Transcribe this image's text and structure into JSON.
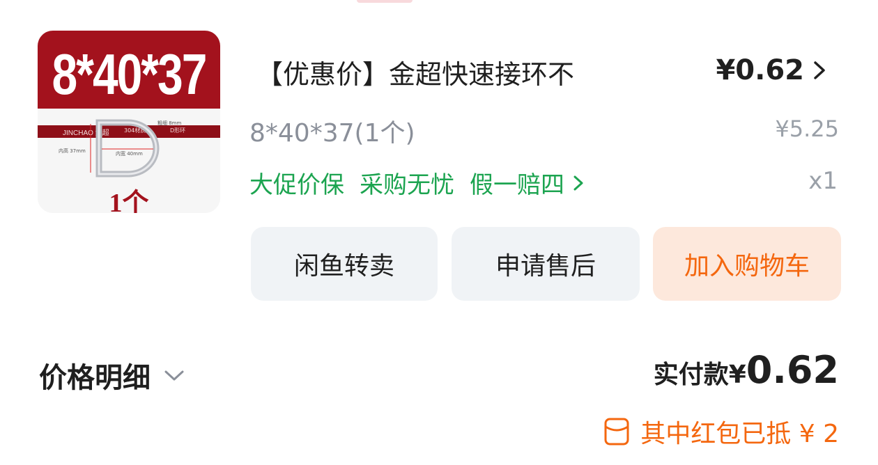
{
  "product": {
    "thumbnail": {
      "headline": "8*40*37",
      "brand": "JINCHAO 金超",
      "material_tag": "304材质",
      "shape_tag": "D形环",
      "count": "1个",
      "dim_inner_height": "内高 37mm",
      "dim_inner_width": "内宽 40mm",
      "dim_thickness": "粗细 8mm"
    },
    "title": "【优惠价】金超快速接环不",
    "price": "¥0.62",
    "spec": "8*40*37(1个)",
    "original_price": "¥5.25",
    "tags": [
      "大促价保",
      "采购无忧",
      "假一赔四"
    ],
    "quantity": "x1"
  },
  "actions": {
    "resell": "闲鱼转卖",
    "after_sales": "申请售后",
    "add_to_cart": "加入购物车"
  },
  "summary": {
    "detail_label": "价格明细",
    "paid_label": "实付款¥",
    "paid_value": "0.62",
    "red_packet": "其中红包已抵 ¥ 2"
  },
  "colors": {
    "green": "#1ca450",
    "orange": "#f4670f",
    "brand_red": "#a3121d"
  },
  "icons": [
    "chevron-right-icon",
    "chevron-down-icon",
    "red-packet-icon"
  ]
}
